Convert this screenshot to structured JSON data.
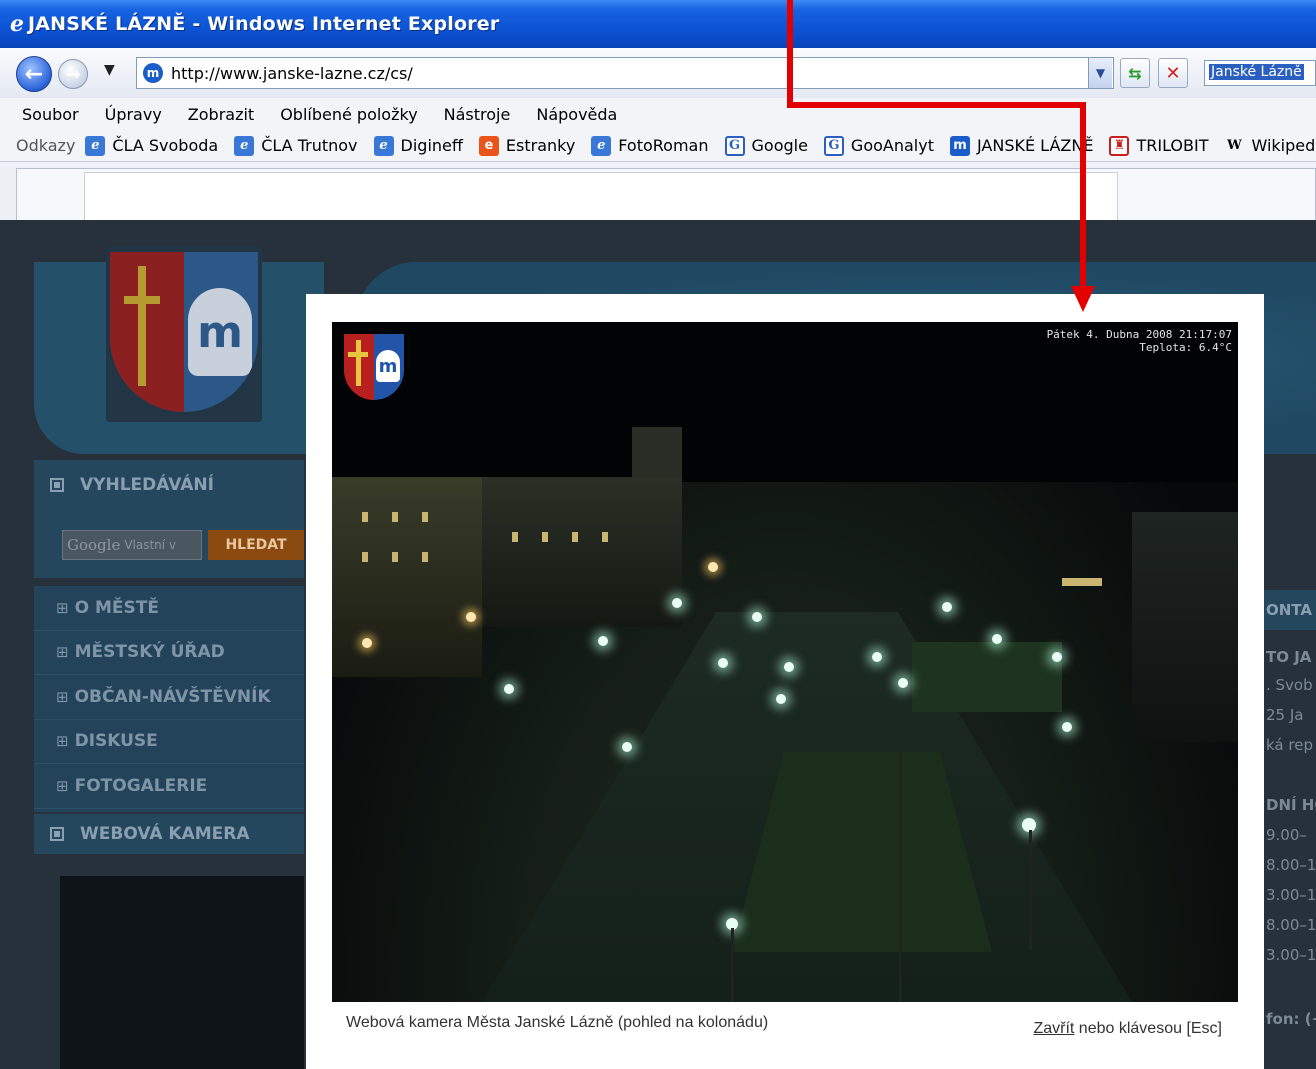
{
  "window": {
    "title": "JANSKÉ LÁZNĚ - Windows Internet Explorer",
    "icon": "ie-logo-icon"
  },
  "address_bar": {
    "url": "http://www.janske-lazne.cz/cs/",
    "search_value": "Janské Lázně"
  },
  "menu": {
    "items": [
      "Soubor",
      "Úpravy",
      "Zobrazit",
      "Oblíbené položky",
      "Nástroje",
      "Nápověda"
    ]
  },
  "links_bar": {
    "label": "Odkazy",
    "items": [
      {
        "label": "ČLA Svoboda",
        "icon": "ie-icon"
      },
      {
        "label": "ČLA Trutnov",
        "icon": "ie-icon"
      },
      {
        "label": "Digineff",
        "icon": "ie-icon"
      },
      {
        "label": "Estranky",
        "icon": "estranky-icon"
      },
      {
        "label": "FotoRoman",
        "icon": "ie-icon"
      },
      {
        "label": "Google",
        "icon": "google-icon"
      },
      {
        "label": "GooAnalyt",
        "icon": "google-icon"
      },
      {
        "label": "JANSKÉ LÁZNĚ",
        "icon": "janske-lazne-icon"
      },
      {
        "label": "TRILOBIT",
        "icon": "trilobit-icon"
      },
      {
        "label": "Wikipedie",
        "icon": "wikipedia-icon"
      }
    ]
  },
  "site": {
    "search_panel": {
      "title": "VYHLEDÁVÁNÍ",
      "google_placeholder": "Vlastní v",
      "google_word": "Google",
      "button": "HLEDAT"
    },
    "nav": [
      "O MĚSTĚ",
      "MĚSTSKÝ ÚŘAD",
      "OBČAN-NÁVŠTĚVNÍK",
      "DISKUSE",
      "FOTOGALERIE"
    ],
    "webcam_panel_title": "WEBOVÁ KAMERA",
    "right_column": {
      "kontakt": "ONTA",
      "lines": [
        "TO JA",
        ". Svob",
        "25 Ja",
        "ká rep",
        "DNÍ HO",
        "9.00–",
        "8.00–1",
        "3.00–1",
        "8.00–1",
        "3.00–1",
        "fon: (+"
      ]
    }
  },
  "lightbox": {
    "overlay_line1": "Pátek 4. Dubna 2008 21:17:07",
    "overlay_line2": "Teplota: 6.4°C",
    "caption": "Webová kamera Města Janské Lázně (pohled na kolonádu)",
    "close_link": "Zavřít",
    "close_rest": " nebo klávesou [Esc]"
  },
  "colors": {
    "annotation_arrow": "#e30000",
    "title_bar": "#0a4fd0"
  }
}
